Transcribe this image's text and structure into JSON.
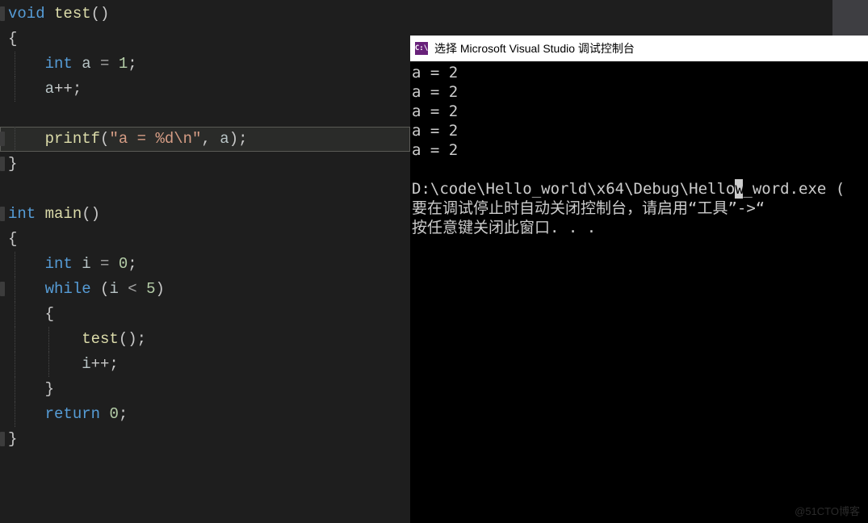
{
  "editor": {
    "lines": [
      {
        "indent": 0,
        "tokens": [
          {
            "t": "void ",
            "c": "kw"
          },
          {
            "t": "test",
            "c": "fn"
          },
          {
            "t": "()",
            "c": "punc"
          }
        ],
        "marker": true
      },
      {
        "indent": 0,
        "tokens": [
          {
            "t": "{",
            "c": "brace"
          }
        ]
      },
      {
        "indent": 1,
        "tokens": [
          {
            "t": "int ",
            "c": "typeint"
          },
          {
            "t": "a ",
            "c": "id"
          },
          {
            "t": "= ",
            "c": "op"
          },
          {
            "t": "1",
            "c": "num"
          },
          {
            "t": ";",
            "c": "punc"
          }
        ]
      },
      {
        "indent": 1,
        "tokens": [
          {
            "t": "a",
            "c": "id"
          },
          {
            "t": "++;",
            "c": "punc"
          }
        ]
      },
      {
        "indent": 0,
        "tokens": [],
        "blank": true
      },
      {
        "indent": 1,
        "tokens": [
          {
            "t": "printf",
            "c": "fn"
          },
          {
            "t": "(",
            "c": "punc"
          },
          {
            "t": "\"a = %d\\n\"",
            "c": "str"
          },
          {
            "t": ", ",
            "c": "punc"
          },
          {
            "t": "a",
            "c": "id"
          },
          {
            "t": ")",
            "c": "punc"
          },
          {
            "t": ";",
            "c": "punc"
          }
        ],
        "highlighted": true,
        "marker": true
      },
      {
        "indent": 0,
        "tokens": [
          {
            "t": "}",
            "c": "brace"
          }
        ],
        "marker": true
      },
      {
        "indent": 0,
        "tokens": [],
        "blank": true
      },
      {
        "indent": 0,
        "tokens": [
          {
            "t": "int ",
            "c": "typeint"
          },
          {
            "t": "main",
            "c": "fn"
          },
          {
            "t": "()",
            "c": "punc"
          }
        ],
        "marker": true
      },
      {
        "indent": 0,
        "tokens": [
          {
            "t": "{",
            "c": "brace"
          }
        ]
      },
      {
        "indent": 1,
        "tokens": [
          {
            "t": "int ",
            "c": "typeint"
          },
          {
            "t": "i ",
            "c": "id"
          },
          {
            "t": "= ",
            "c": "op"
          },
          {
            "t": "0",
            "c": "num"
          },
          {
            "t": ";",
            "c": "punc"
          }
        ]
      },
      {
        "indent": 1,
        "tokens": [
          {
            "t": "while ",
            "c": "kw"
          },
          {
            "t": "(",
            "c": "punc"
          },
          {
            "t": "i ",
            "c": "id"
          },
          {
            "t": "< ",
            "c": "op"
          },
          {
            "t": "5",
            "c": "num"
          },
          {
            "t": ")",
            "c": "punc"
          }
        ],
        "marker": true
      },
      {
        "indent": 1,
        "tokens": [
          {
            "t": "{",
            "c": "brace"
          }
        ]
      },
      {
        "indent": 2,
        "tokens": [
          {
            "t": "test",
            "c": "fn"
          },
          {
            "t": "()",
            "c": "punc"
          },
          {
            "t": ";",
            "c": "punc"
          }
        ]
      },
      {
        "indent": 2,
        "tokens": [
          {
            "t": "i",
            "c": "id"
          },
          {
            "t": "++;",
            "c": "punc"
          }
        ]
      },
      {
        "indent": 1,
        "tokens": [
          {
            "t": "}",
            "c": "brace"
          }
        ]
      },
      {
        "indent": 1,
        "tokens": [
          {
            "t": "return ",
            "c": "kw"
          },
          {
            "t": "0",
            "c": "num"
          },
          {
            "t": ";",
            "c": "punc"
          }
        ]
      },
      {
        "indent": 0,
        "tokens": [
          {
            "t": "}",
            "c": "brace"
          }
        ],
        "marker": true
      }
    ]
  },
  "console": {
    "icon_text": "C:\\",
    "title": "选择 Microsoft Visual Studio 调试控制台",
    "output_lines": [
      "a = 2",
      "a = 2",
      "a = 2",
      "a = 2",
      "a = 2"
    ],
    "path_prefix": "D:\\code\\Hello_world\\x64\\Debug\\Hello",
    "path_cursor_char": "w",
    "path_suffix": "_word.exe (",
    "hint1_prefix": "要在调试停止时自动关闭控制台，请启用“工具”->",
    "hint1_quote": "“",
    "hint2": "按任意键关闭此窗口. . ."
  },
  "watermark": "@51CTO博客"
}
